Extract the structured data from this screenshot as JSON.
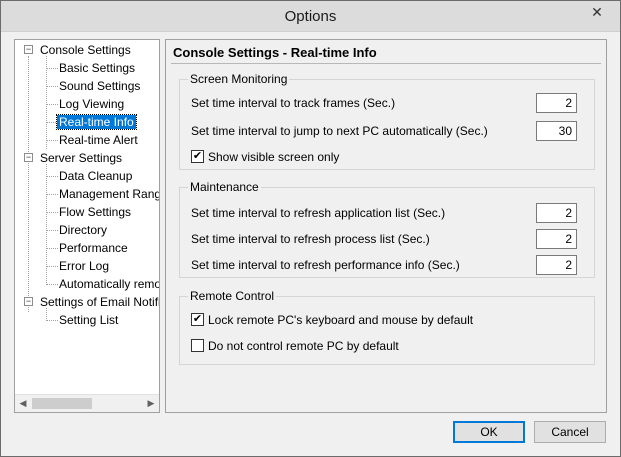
{
  "window": {
    "title": "Options",
    "close_glyph": "✕"
  },
  "tree": {
    "collapse_glyph": "−",
    "nodes": [
      {
        "label": "Console Settings"
      },
      {
        "label": "Basic Settings"
      },
      {
        "label": "Sound Settings"
      },
      {
        "label": "Log Viewing"
      },
      {
        "label": "Real-time Info"
      },
      {
        "label": "Real-time Alert"
      },
      {
        "label": "Server Settings"
      },
      {
        "label": "Data Cleanup"
      },
      {
        "label": "Management Range"
      },
      {
        "label": "Flow Settings"
      },
      {
        "label": "Directory"
      },
      {
        "label": "Performance"
      },
      {
        "label": "Error Log"
      },
      {
        "label": "Automatically remove"
      },
      {
        "label": "Settings of Email Notification"
      },
      {
        "label": "Setting List"
      }
    ],
    "scroll_left": "◀",
    "scroll_right": "▶"
  },
  "content": {
    "title": "Console Settings - Real-time Info",
    "screen_monitoring": {
      "label": "Screen Monitoring",
      "track_frames_label": "Set time interval to track frames (Sec.)",
      "track_frames_value": "2",
      "jump_pc_label": "Set time interval to jump to next PC automatically (Sec.)",
      "jump_pc_value": "30",
      "show_visible_label": "Show visible screen only",
      "show_visible_checked": "✔"
    },
    "maintenance": {
      "label": "Maintenance",
      "refresh_app_label": "Set time interval to refresh application list (Sec.)",
      "refresh_app_value": "2",
      "refresh_proc_label": "Set time interval to refresh process list (Sec.)",
      "refresh_proc_value": "2",
      "refresh_perf_label": "Set time interval to refresh performance info (Sec.)",
      "refresh_perf_value": "2"
    },
    "remote_control": {
      "label": "Remote Control",
      "lock_label": "Lock remote PC's keyboard and mouse by default",
      "lock_checked": "✔",
      "no_control_label": "Do not control remote PC by default"
    }
  },
  "buttons": {
    "ok": "OK",
    "cancel": "Cancel"
  }
}
